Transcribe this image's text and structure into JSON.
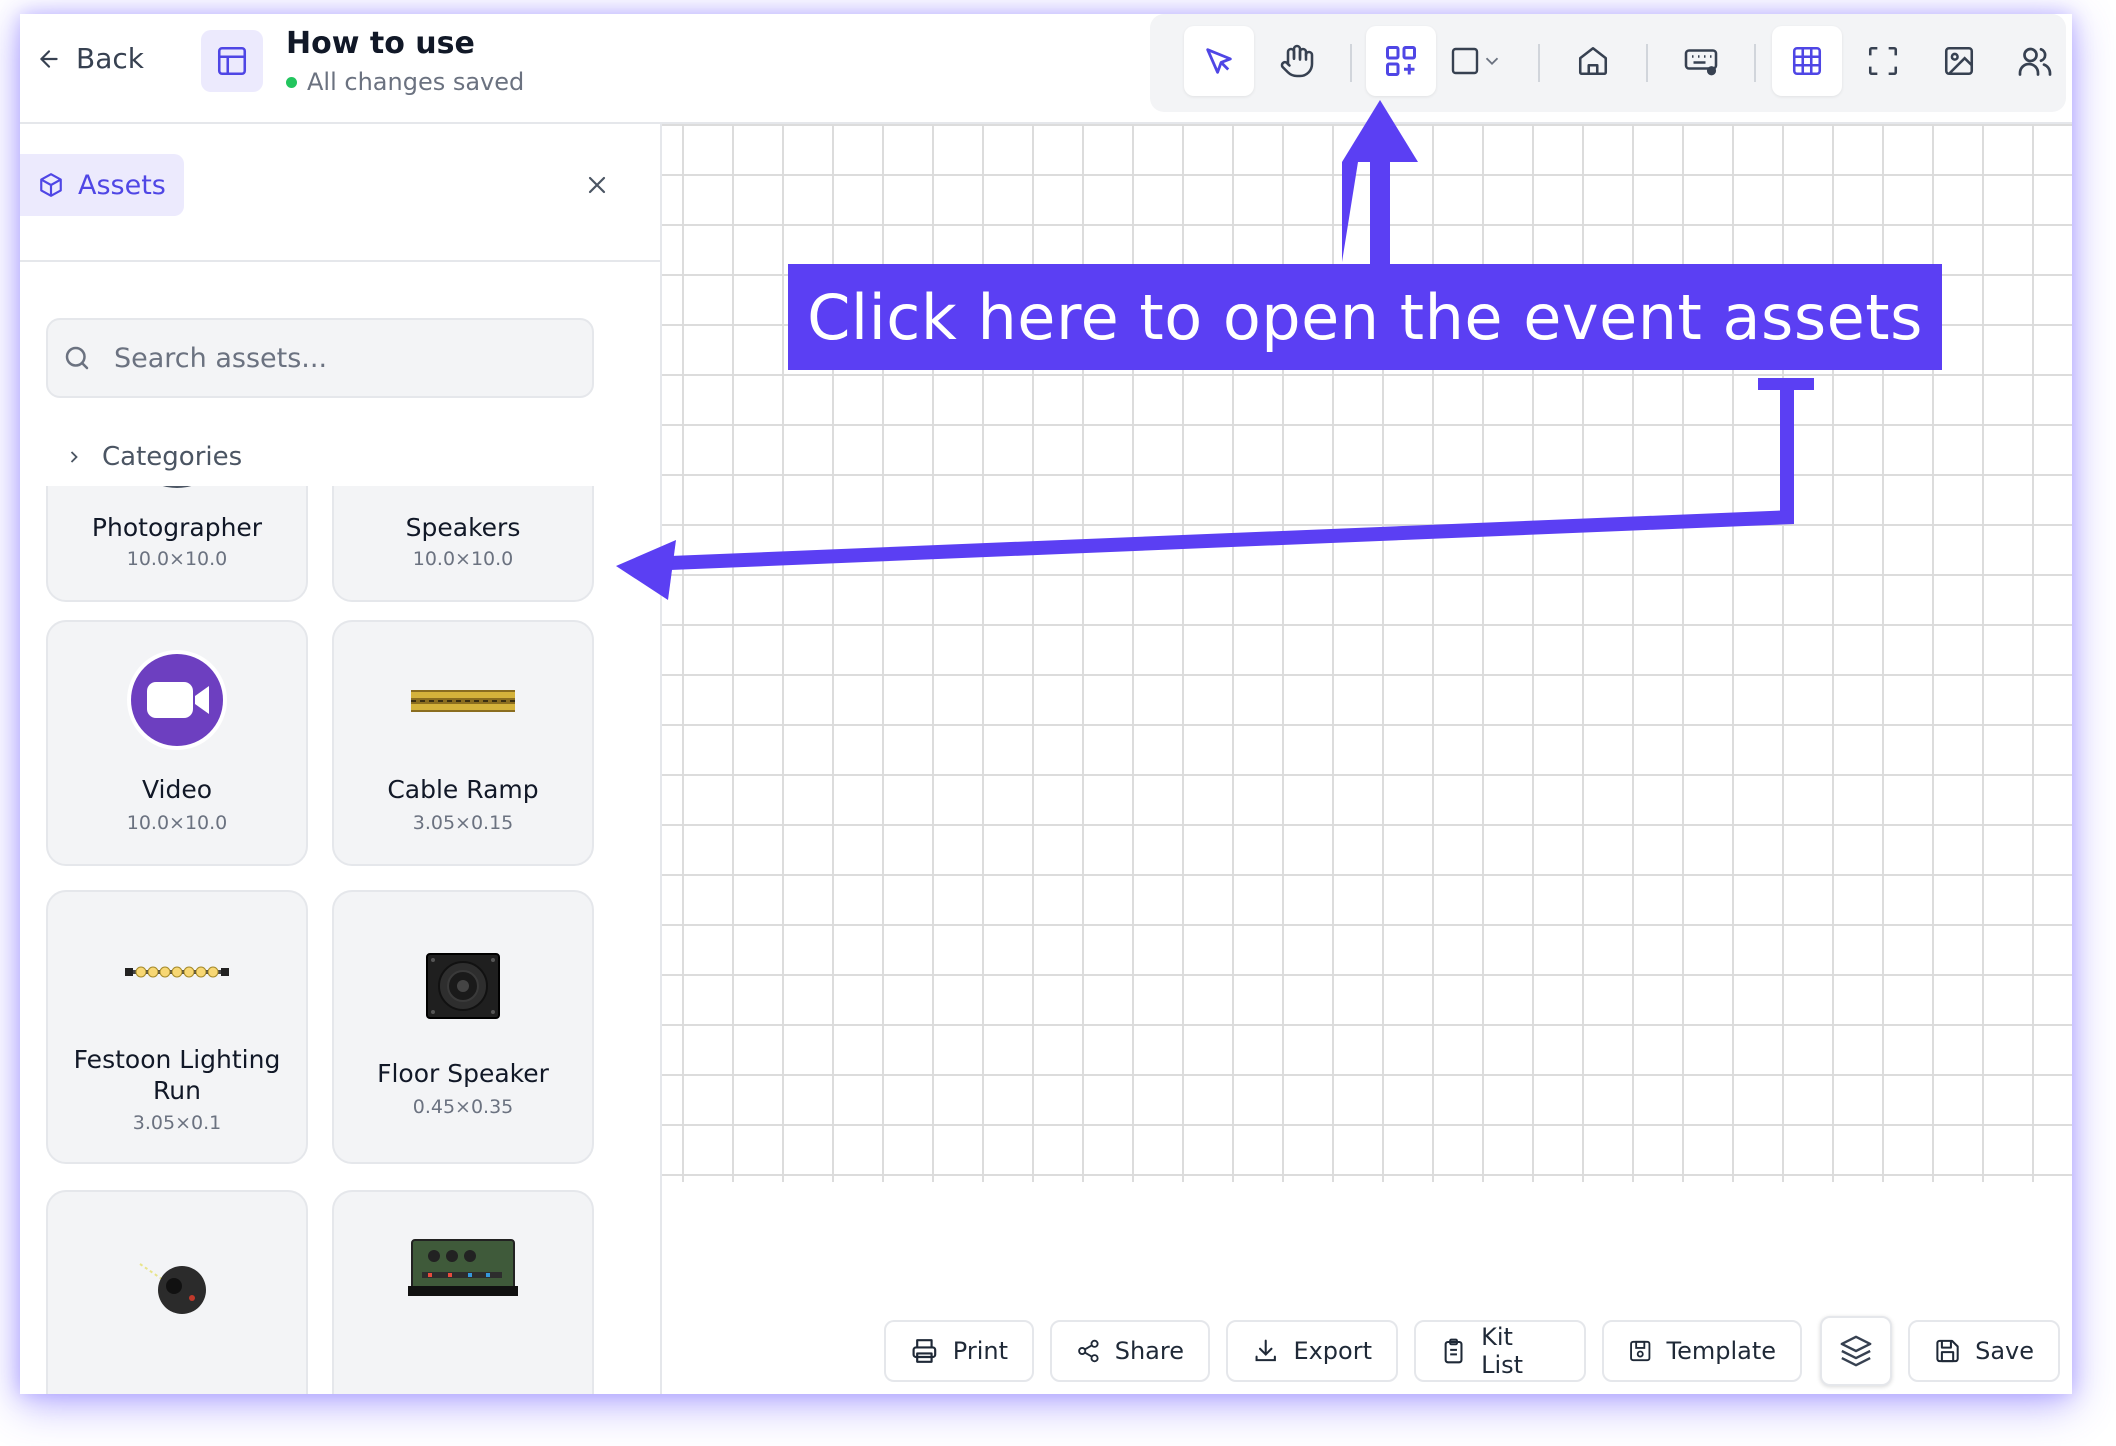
{
  "header": {
    "back_label": "Back",
    "title": "How to use",
    "status": "All changes saved"
  },
  "toolbar": {
    "tools": [
      "select-tool",
      "pan-tool",
      "assets-tool",
      "shapes-tool",
      "venue-tool",
      "keyboard-tool",
      "grid-tool",
      "fullscreen-tool",
      "image-tool",
      "users-tool"
    ],
    "active": [
      "select-tool",
      "assets-tool",
      "grid-tool"
    ]
  },
  "sidebar": {
    "tab_label": "Assets",
    "search_placeholder": "Search assets...",
    "categories_label": "Categories",
    "assets": [
      {
        "name": "Photographer",
        "dims": "10.0×10.0"
      },
      {
        "name": "Speakers",
        "dims": "10.0×10.0"
      },
      {
        "name": "Video",
        "dims": "10.0×10.0"
      },
      {
        "name": "Cable Ramp",
        "dims": "3.05×0.15"
      },
      {
        "name": "Festoon Lighting Run",
        "dims": "3.05×0.1"
      },
      {
        "name": "Floor Speaker",
        "dims": "0.45×0.35"
      }
    ]
  },
  "annotation": {
    "callout": "Click here to open the event assets",
    "color": "#5b3ff3"
  },
  "bottom_bar": {
    "print": "Print",
    "share": "Share",
    "export": "Export",
    "kit_list": "Kit List",
    "template": "Template",
    "save": "Save"
  },
  "colors": {
    "accent": "#4f46e5",
    "accent_light": "#eceafd",
    "status_green": "#22c55e",
    "video_purple": "#6d3fc0"
  }
}
